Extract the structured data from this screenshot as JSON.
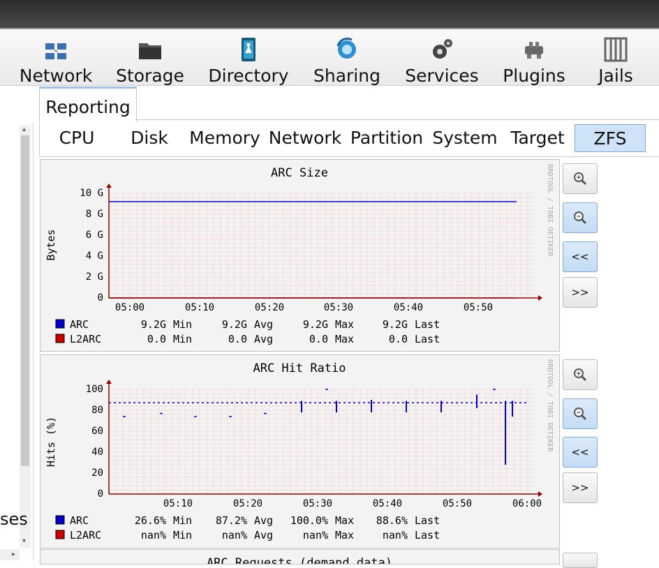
{
  "nav": {
    "items": [
      {
        "label": "Network",
        "icon": "network-icon"
      },
      {
        "label": "Storage",
        "icon": "storage-icon"
      },
      {
        "label": "Directory",
        "icon": "directory-icon"
      },
      {
        "label": "Sharing",
        "icon": "sharing-icon"
      },
      {
        "label": "Services",
        "icon": "services-icon"
      },
      {
        "label": "Plugins",
        "icon": "plugins-icon"
      },
      {
        "label": "Jails",
        "icon": "jails-icon"
      }
    ]
  },
  "tree": {
    "partial_text": "ses"
  },
  "tab": {
    "label": "Reporting"
  },
  "subtabs": [
    {
      "label": "CPU"
    },
    {
      "label": "Disk"
    },
    {
      "label": "Memory"
    },
    {
      "label": "Network"
    },
    {
      "label": "Partition"
    },
    {
      "label": "System"
    },
    {
      "label": "Target"
    },
    {
      "label": "ZFS",
      "active": true
    }
  ],
  "graph_buttons": {
    "zoom_in": "zoom-in-icon",
    "zoom_out": "zoom-out-icon",
    "back": "<<",
    "forward": ">>"
  },
  "watermark": "RRDTOOL / TOBI OETIKER",
  "colors": {
    "arc": "#0000cc",
    "l2arc": "#cc0000",
    "grid": "#f0b0b0",
    "axis": "#990000"
  },
  "chart_data": [
    {
      "type": "line",
      "title": "ARC Size",
      "ylabel": "Bytes",
      "y_ticks": [
        "10 G",
        "8 G",
        "6 G",
        "4 G",
        "2 G",
        "0"
      ],
      "x_ticks": [
        "05:00",
        "05:10",
        "05:20",
        "05:30",
        "05:40",
        "05:50"
      ],
      "series": [
        {
          "name": "ARC",
          "values": [
            9.2,
            9.2
          ]
        },
        {
          "name": "L2ARC",
          "values": [
            0.0,
            0.0
          ]
        }
      ],
      "legend": [
        {
          "name": "ARC",
          "min": "9.2G",
          "avg": "9.2G",
          "max": "9.2G",
          "last": "9.2G"
        },
        {
          "name": "L2ARC",
          "min": "0.0",
          "avg": "0.0",
          "max": "0.0",
          "last": "0.0"
        }
      ],
      "legend_words": {
        "min": "Min",
        "avg": "Avg",
        "max": "Max",
        "last": "Last"
      }
    },
    {
      "type": "line",
      "title": "ARC Hit Ratio",
      "ylabel": "Hits (%)",
      "y_ticks": [
        "100",
        "80",
        "60",
        "40",
        "20",
        "0"
      ],
      "x_ticks": [
        "05:10",
        "05:20",
        "05:30",
        "05:40",
        "05:50",
        "06:00"
      ],
      "average_line": 87.2,
      "series": [
        {
          "name": "ARC",
          "segments": [
            [
              74,
              74
            ],
            [
              77,
              77
            ],
            [
              74,
              74
            ],
            [
              74,
              74
            ],
            [
              77,
              77
            ],
            [
              78,
              89
            ],
            [
              100,
              100
            ],
            [
              78,
              89
            ],
            [
              78,
              90
            ],
            [
              78,
              89
            ],
            [
              78,
              89
            ],
            [
              82,
              95
            ],
            [
              100,
              100
            ],
            [
              28,
              89
            ],
            [
              74,
              89
            ]
          ]
        },
        {
          "name": "L2ARC",
          "segments": []
        }
      ],
      "legend": [
        {
          "name": "ARC",
          "min": "26.6%",
          "avg": "87.2%",
          "max": "100.0%",
          "last": "88.6%"
        },
        {
          "name": "L2ARC",
          "min": "nan%",
          "avg": "nan%",
          "max": "nan%",
          "last": "nan%"
        }
      ],
      "legend_words": {
        "min": "Min",
        "avg": "Avg",
        "max": "Max",
        "last": "Last"
      }
    },
    {
      "type": "line",
      "title": "ARC Requests (demand data)"
    }
  ]
}
